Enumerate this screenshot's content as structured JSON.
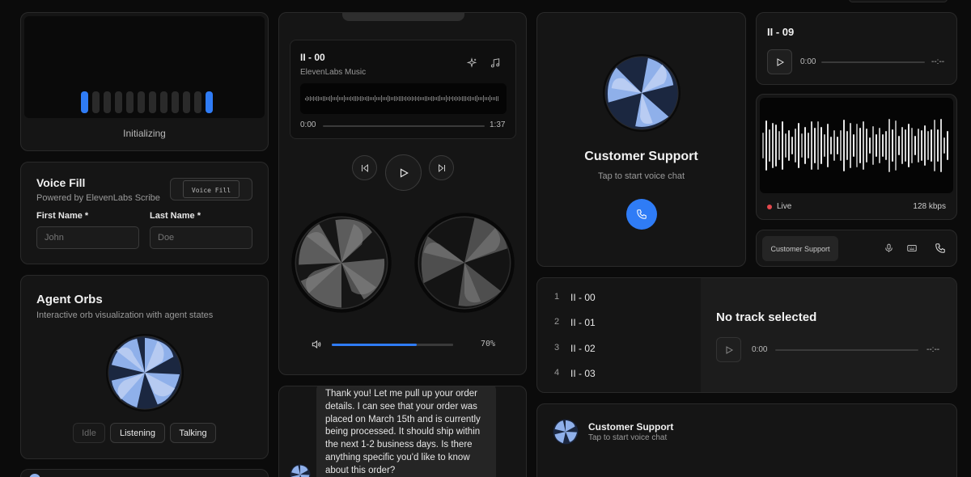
{
  "init_card": {
    "status_label": "Initializing"
  },
  "voice_fill": {
    "title": "Voice Fill",
    "subtitle": "Powered by ElevenLabs Scribe",
    "button_label": "Voice Fill",
    "first_name_label": "First Name *",
    "first_name_placeholder": "John",
    "last_name_label": "Last Name *",
    "last_name_placeholder": "Doe"
  },
  "agent_orbs": {
    "title": "Agent Orbs",
    "subtitle": "Interactive orb visualization with agent states",
    "states": [
      "Idle",
      "Listening",
      "Talking"
    ]
  },
  "music_player": {
    "track_title": "II - 00",
    "artist": "ElevenLabs Music",
    "time_current": "0:00",
    "time_total": "1:37",
    "volume_label": "70%",
    "volume_value": 0.7
  },
  "chat": {
    "message": "Thank you! Let me pull up your order details. I can see that your order was placed on March 15th and is currently being processed. It should ship within the next 1-2 business days. Is there anything specific you'd like to know about this order?"
  },
  "support_card": {
    "title": "Customer Support",
    "subtitle": "Tap to start voice chat"
  },
  "playlist": {
    "tracks": [
      {
        "num": "1",
        "title": "II - 00"
      },
      {
        "num": "2",
        "title": "II - 01"
      },
      {
        "num": "3",
        "title": "II - 02"
      },
      {
        "num": "4",
        "title": "II - 03"
      }
    ],
    "empty_title": "No track selected",
    "time_current": "0:00",
    "time_total": "--:--"
  },
  "support_row": {
    "title": "Customer Support",
    "subtitle": "Tap to start voice chat"
  },
  "mini_player": {
    "track_title": "II - 09",
    "time_current": "0:00",
    "time_total": "--:--"
  },
  "live_wave": {
    "status": "Live",
    "bitrate": "128 kbps"
  },
  "support_bar": {
    "label": "Customer Support"
  },
  "colors": {
    "accent": "#2f7cf6",
    "orb_blue": "#8fb0ea",
    "live_red": "#e5484d"
  }
}
